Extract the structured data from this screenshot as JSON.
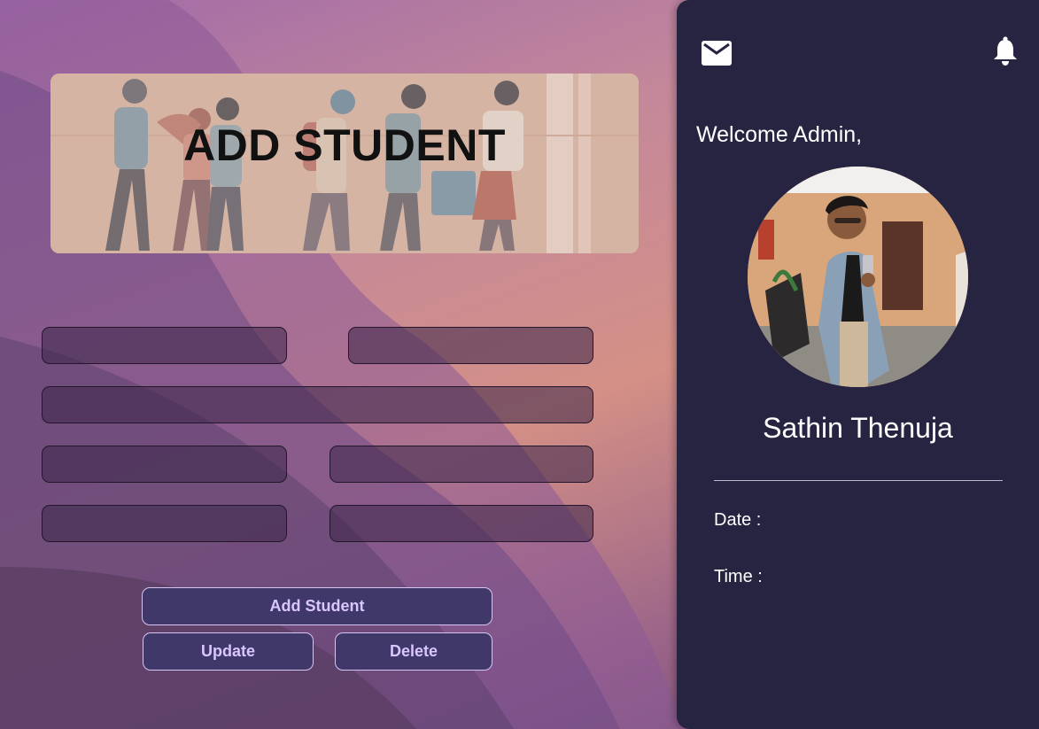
{
  "banner": {
    "title": "ADD STUDENT"
  },
  "form": {
    "fields": [
      {
        "name": "field-1",
        "value": "",
        "placeholder": ""
      },
      {
        "name": "field-2",
        "value": "",
        "placeholder": ""
      },
      {
        "name": "field-3",
        "value": "",
        "placeholder": ""
      },
      {
        "name": "field-4",
        "value": "",
        "placeholder": ""
      },
      {
        "name": "field-5",
        "value": "",
        "placeholder": ""
      },
      {
        "name": "field-6",
        "value": "",
        "placeholder": ""
      },
      {
        "name": "field-7",
        "value": "",
        "placeholder": ""
      }
    ],
    "buttons": {
      "add": "Add Student",
      "update": "Update",
      "delete": "Delete"
    }
  },
  "panel": {
    "icons": {
      "mail": "mail-icon",
      "bell": "bell-icon"
    },
    "welcome": "Welcome Admin,",
    "user_name": "Sathin Thenuja",
    "date_label": "Date :",
    "time_label": "Time :"
  },
  "colors": {
    "panel_bg": "#262441",
    "button_bg": "#3f3868",
    "button_text": "#d9c6ff",
    "field_bg": "#3a2648"
  }
}
